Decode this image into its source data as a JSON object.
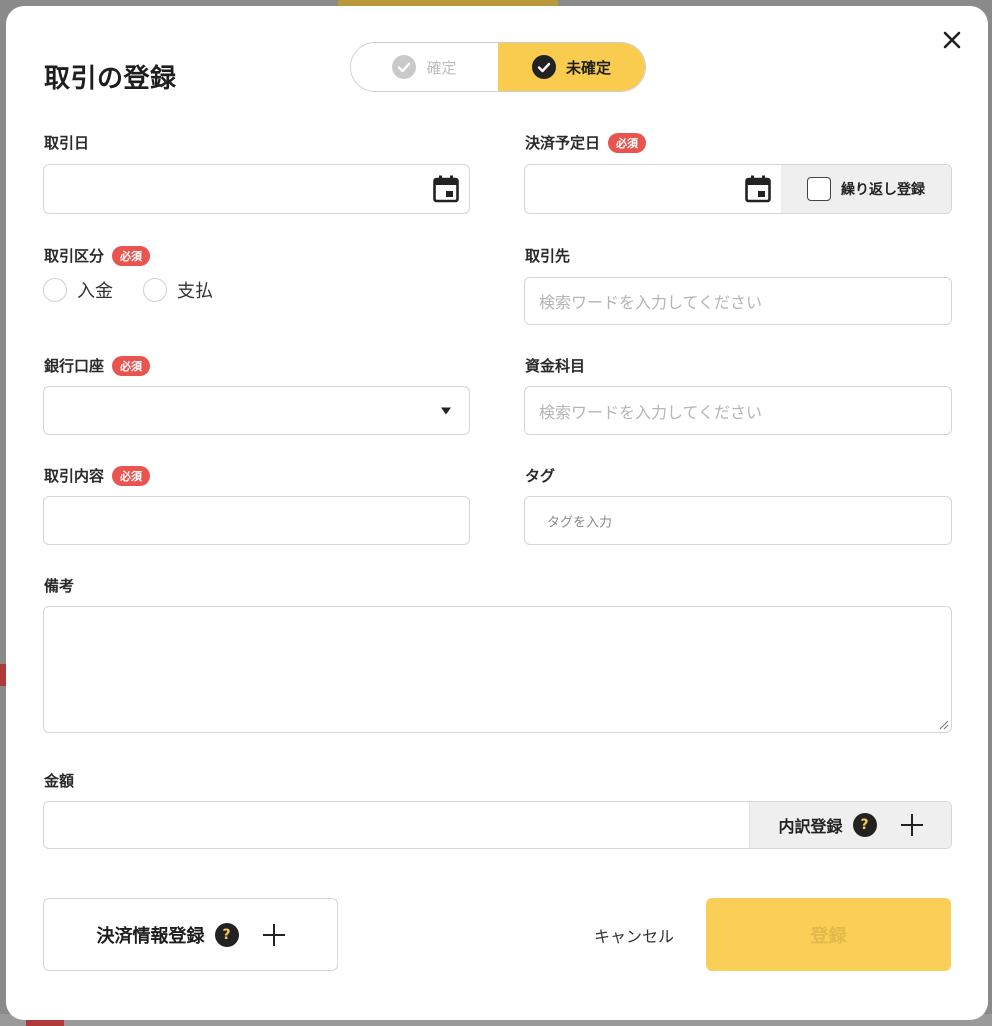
{
  "dialog": {
    "title": "取引の登録",
    "close_icon": "close-icon"
  },
  "status_toggle": {
    "confirmed_label": "確定",
    "unconfirmed_label": "未確定",
    "selected": "未確定"
  },
  "required_badge": "必須",
  "fields": {
    "transaction_date": {
      "label": "取引日",
      "value": ""
    },
    "settlement_date": {
      "label": "決済予定日",
      "value": "",
      "repeat_label": "繰り返し登録"
    },
    "transaction_type": {
      "label": "取引区分",
      "options": [
        "入金",
        "支払"
      ]
    },
    "partner": {
      "label": "取引先",
      "placeholder": "検索ワードを入力してください"
    },
    "bank_account": {
      "label": "銀行口座",
      "value": ""
    },
    "fund_subject": {
      "label": "資金科目",
      "placeholder": "検索ワードを入力してください"
    },
    "content": {
      "label": "取引内容",
      "value": ""
    },
    "tag": {
      "label": "タグ",
      "placeholder": "タグを入力"
    },
    "remarks": {
      "label": "備考",
      "value": ""
    },
    "amount": {
      "label": "金額",
      "value": "",
      "breakdown_label": "内訳登録",
      "help_glyph": "?"
    }
  },
  "footer": {
    "payment_info_label": "決済情報登録",
    "help_glyph": "?",
    "cancel_label": "キャンセル",
    "submit_label": "登録"
  },
  "colors": {
    "accent": "#f9cc4f",
    "required": "#e9544f",
    "placeholder": "#b5b5b5"
  }
}
